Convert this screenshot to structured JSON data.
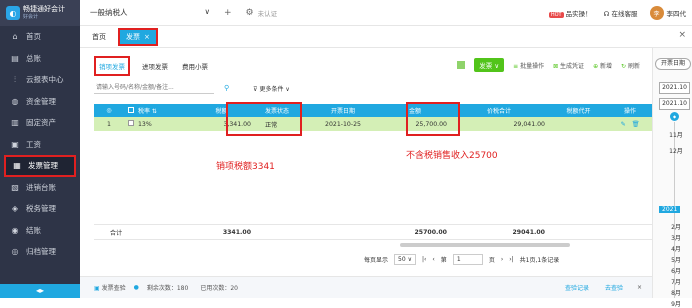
{
  "app": {
    "name": "畅捷通好会计",
    "subname": "好会计"
  },
  "sidebar": {
    "items": [
      {
        "label": "首页",
        "icon": "home-icon",
        "glyph": "⌂"
      },
      {
        "label": "总账",
        "icon": "ledger-icon",
        "glyph": "▤"
      },
      {
        "label": "云报表中心",
        "icon": "chart-icon",
        "glyph": "⫶"
      },
      {
        "label": "资金管理",
        "icon": "money-icon",
        "glyph": "◍"
      },
      {
        "label": "固定资产",
        "icon": "building-icon",
        "glyph": "▥"
      },
      {
        "label": "工资",
        "icon": "salary-icon",
        "glyph": "▣"
      },
      {
        "label": "发票管理",
        "icon": "invoice-icon",
        "glyph": "▦"
      },
      {
        "label": "进销台账",
        "icon": "stock-icon",
        "glyph": "▧"
      },
      {
        "label": "税务管理",
        "icon": "tax-icon",
        "glyph": "◈"
      },
      {
        "label": "结账",
        "icon": "close-books-icon",
        "glyph": "◉"
      },
      {
        "label": "归档管理",
        "icon": "archive-icon",
        "glyph": "◎"
      }
    ]
  },
  "topbar": {
    "taxpayer": "一般纳税人",
    "cert": "未认证",
    "hot": "HOT",
    "promo": "品实操！",
    "service": "在线客服",
    "user": "李四代",
    "avatar": "李"
  },
  "tabs": {
    "home": "首页",
    "active": "发票",
    "close": "×"
  },
  "subtabs": [
    "销项发票",
    "进项发票",
    "费用小票"
  ],
  "actions": {
    "pdf": "",
    "invoice": "发票 ∨",
    "batch": "批量操作",
    "voucher": "生成凭证",
    "add": "新增",
    "refresh": "刷新"
  },
  "search": {
    "placeholder": "请输入号码/名称/金额/备注...",
    "more": "更多条件"
  },
  "table": {
    "headers": {
      "idx": "◎",
      "rate": "税率",
      "tax": "税额",
      "status": "发票状态",
      "date": "开票日期",
      "amount": "金额",
      "total": "价税合计",
      "sum": "税额代开",
      "op": "操作"
    },
    "rows": [
      {
        "idx": "1",
        "rate": "13%",
        "tax": "3,341.00",
        "status": "正常",
        "date": "2021-10-25",
        "amount": "25,700.00",
        "total": "29,041.00"
      }
    ],
    "footer": {
      "label": "合计",
      "tax": "3341.00",
      "amount": "25700.00",
      "total": "29041.00"
    }
  },
  "annotations": {
    "tax": "销项税额3341",
    "amount": "不含税销售收入25700"
  },
  "pager": {
    "per_page_label": "每页显示",
    "per_page": "50",
    "page_label_pre": "第",
    "page": "1",
    "page_label_post": "页",
    "summary": "共1页,1条记录"
  },
  "bottombar": {
    "check": "发票查验",
    "remaining": "剩余次数：180",
    "used": "已用次数：20",
    "history": "查验记录",
    "collapse": "去查验"
  },
  "rightpanel": {
    "button": "开票日期",
    "date1": "2021.10",
    "date2": "2021.10",
    "months_top": [
      "11月",
      "12月"
    ],
    "year": "2021",
    "months": [
      "2月",
      "3月",
      "4月",
      "5月",
      "6月",
      "7月",
      "8月",
      "9月"
    ]
  }
}
